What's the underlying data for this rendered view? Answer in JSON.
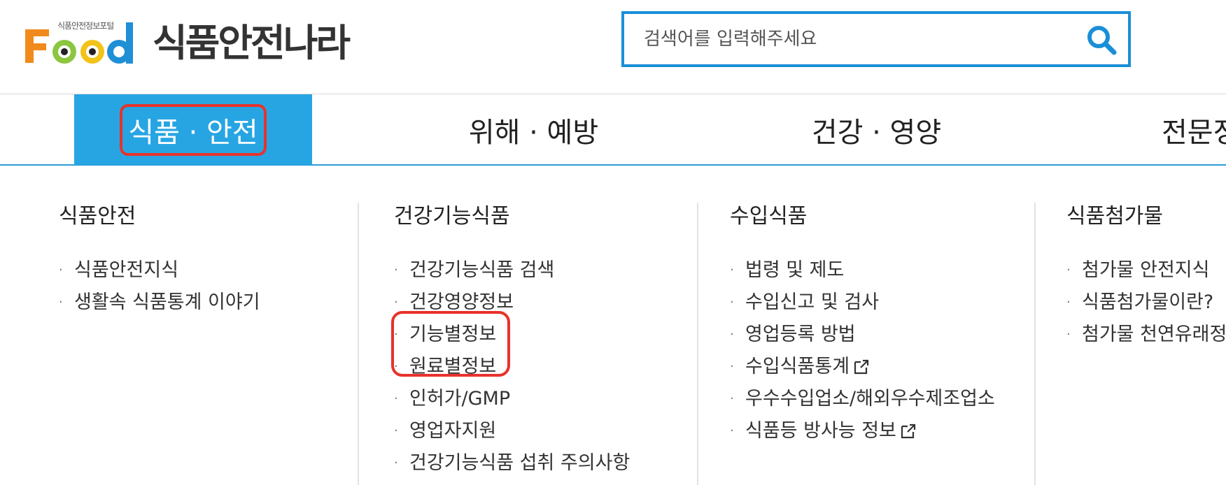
{
  "header": {
    "logo_tagline": "식품안전정보포털",
    "logo_word": "Food",
    "site_name": "식품안전나라"
  },
  "search": {
    "placeholder": "검색어를 입력해주세요"
  },
  "gnb": {
    "items": [
      {
        "label": "식품 · 안전"
      },
      {
        "label": "위해 · 예방"
      },
      {
        "label": "건강 · 영양"
      },
      {
        "label": "전문정"
      }
    ]
  },
  "menu": {
    "columns": [
      {
        "title": "식품안전",
        "items": [
          "식품안전지식",
          "생활속 식품통계 이야기"
        ]
      },
      {
        "title": "건강기능식품",
        "items": [
          "건강기능식품 검색",
          "건강영양정보",
          "기능별정보",
          "원료별정보",
          "인허가/GMP",
          "영업자지원",
          "건강기능식품 섭취 주의사항"
        ]
      },
      {
        "title": "수입식품",
        "items": [
          "법령 및 제도",
          "수입신고 및 검사",
          "영업등록 방법",
          "수입식품통계",
          "우수수입업소/해외우수제조업소",
          "식품등 방사능 정보"
        ]
      },
      {
        "title": "식품첨가물",
        "items": [
          "첨가물 안전지식",
          "식품첨가물이란?",
          "첨가물 천연유래정"
        ]
      }
    ]
  },
  "colors": {
    "accent": "#27a5e3",
    "search_border": "#1a8fd8",
    "highlight": "#e8322b"
  }
}
